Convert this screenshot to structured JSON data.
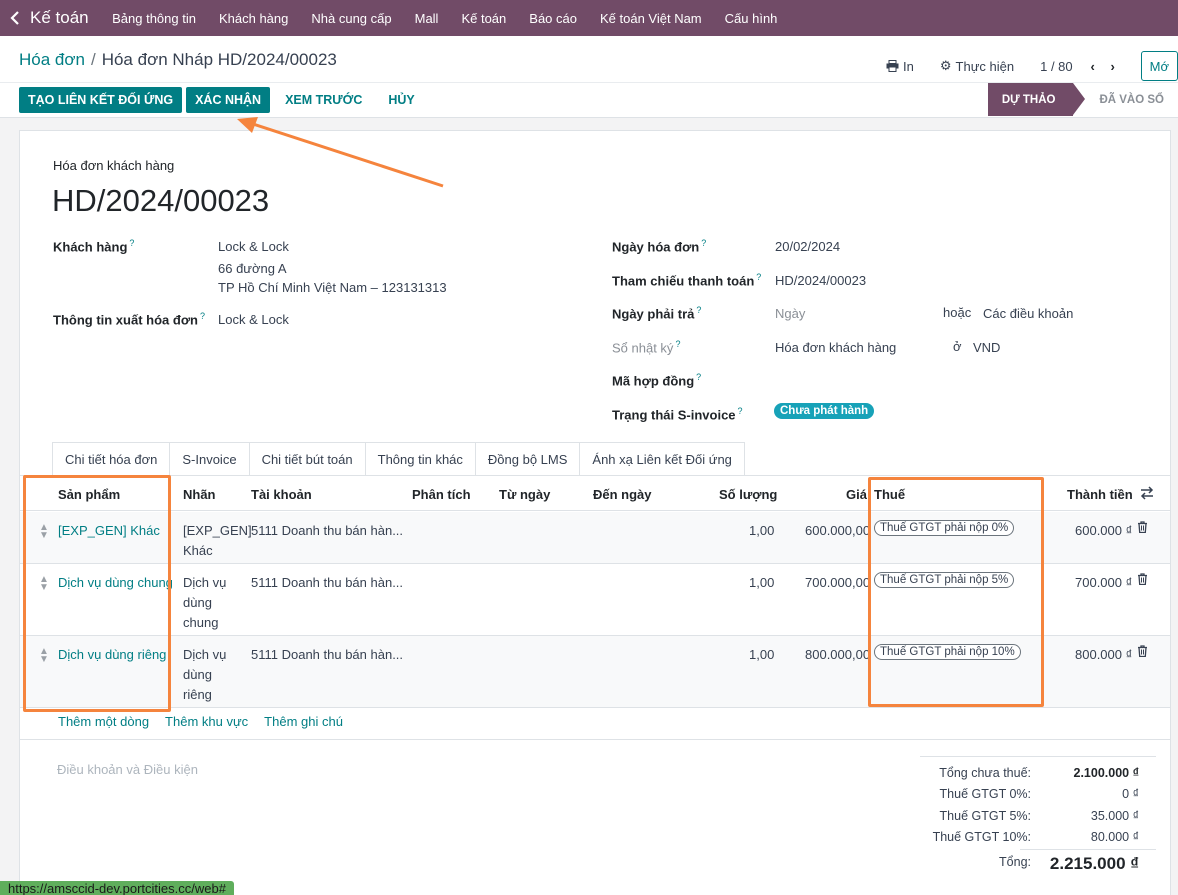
{
  "navbar": {
    "app_name": "Kế toán",
    "items": [
      "Bảng thông tin",
      "Khách hàng",
      "Nhà cung cấp",
      "Mall",
      "Kế toán",
      "Báo cáo",
      "Kế toán Việt Nam",
      "Cấu hình"
    ]
  },
  "breadcrumb": {
    "parent": "Hóa đơn",
    "current": "Hóa đơn Nháp HD/2024/00023"
  },
  "control": {
    "print_label": "In",
    "action_label": "Thực hiện",
    "pager": "1 / 80",
    "new_label": "Mớ"
  },
  "actions": {
    "create_link": "TẠO LIÊN KẾT ĐỐI ỨNG",
    "confirm": "XÁC NHẬN",
    "preview": "XEM TRƯỚC",
    "cancel": "HỦY"
  },
  "status": {
    "draft": "DỰ THẢO",
    "posted": "ĐÃ VÀO SỔ"
  },
  "form": {
    "doc_type": "Hóa đơn khách hàng",
    "doc_name": "HD/2024/00023",
    "customer_label": "Khách hàng",
    "customer_name": "Lock & Lock",
    "customer_street": "66 đường A",
    "customer_city": "TP Hồ Chí Minh Việt Nam – 123131313",
    "invoice_info_label": "Thông tin xuất hóa đơn",
    "invoice_info_value": "Lock & Lock",
    "invoice_date_label": "Ngày hóa đơn",
    "invoice_date_value": "20/02/2024",
    "payment_ref_label": "Tham chiếu thanh toán",
    "payment_ref_value": "HD/2024/00023",
    "due_date_label": "Ngày phải trả",
    "due_date_value": "Ngày",
    "or_label": "hoặc",
    "payment_terms": "Các điều khoản",
    "journal_label": "Sổ nhật ký",
    "journal_value": "Hóa đơn khách hàng",
    "in_label": "ở",
    "currency": "VND",
    "contract_label": "Mã hợp đồng",
    "sinvoice_status_label": "Trạng thái S-invoice",
    "sinvoice_status_value": "Chưa phát hành",
    "help_mark": "?"
  },
  "tabs": [
    "Chi tiết hóa đơn",
    "S-Invoice",
    "Chi tiết bút toán",
    "Thông tin khác",
    "Đồng bộ LMS",
    "Ánh xạ Liên kết Đối ứng"
  ],
  "table": {
    "headers": {
      "product": "Sản phẩm",
      "label": "Nhãn",
      "account": "Tài khoản",
      "analytic": "Phân tích",
      "from_date": "Từ ngày",
      "to_date": "Đến ngày",
      "quantity": "Số lượng",
      "price": "Giá",
      "tax": "Thuế",
      "subtotal": "Thành tiền"
    },
    "rows": [
      {
        "product": "[EXP_GEN] Khác",
        "label_lines": [
          "[EXP_GEN]",
          "Khác"
        ],
        "account": "5111 Doanh thu bán hàn...",
        "quantity": "1,00",
        "price": "600.000,00",
        "tax": "Thuế GTGT phải nộp 0%",
        "subtotal": "600.000 ₫"
      },
      {
        "product": "Dịch vụ dùng chung",
        "label_lines": [
          "Dịch vụ",
          "dùng",
          "chung"
        ],
        "account": "5111 Doanh thu bán hàn...",
        "quantity": "1,00",
        "price": "700.000,00",
        "tax": "Thuế GTGT phải nộp 5%",
        "subtotal": "700.000 ₫"
      },
      {
        "product": "Dịch vụ dùng riêng",
        "label_lines": [
          "Dịch vụ",
          "dùng",
          "riêng"
        ],
        "account": "5111 Doanh thu bán hàn...",
        "quantity": "1,00",
        "price": "800.000,00",
        "tax": "Thuế GTGT phải nộp 10%",
        "subtotal": "800.000 ₫"
      }
    ],
    "add_line": "Thêm một dòng",
    "add_section": "Thêm khu vực",
    "add_note": "Thêm ghi chú"
  },
  "terms_placeholder": "Điều khoản và Điều kiện",
  "totals": {
    "untaxed_label": "Tổng chưa thuế:",
    "untaxed_value": "2.100.000 ₫",
    "tax0_label": "Thuế GTGT 0%:",
    "tax0_value": "0 ₫",
    "tax5_label": "Thuế GTGT 5%:",
    "tax5_value": "35.000 ₫",
    "tax10_label": "Thuế GTGT 10%:",
    "tax10_value": "80.000 ₫",
    "total_label": "Tổng:",
    "total_value": "2.215.000 ₫"
  },
  "status_url": "https://amsccid-dev.portcities.cc/web#",
  "annotation_color": "#f5843d",
  "brand_color": "#714b67",
  "accent_color": "#017e84"
}
